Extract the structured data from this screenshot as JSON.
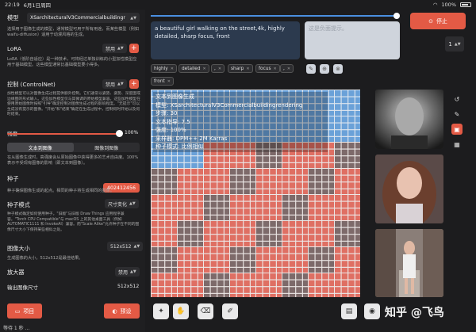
{
  "statusbar": {
    "time": "22:19",
    "date": "6月1日周四",
    "battery": "100%"
  },
  "left": {
    "model_label": "模型",
    "model_value": "XSarchitecturalV3Commercialbuildingr",
    "model_desc": "选择用于图像生成的模型，通常模型可用于所有用途，而某些模型（例如 waifu-diffusion）适用于动漫风格的生成。",
    "lora_label": "LoRA",
    "lora_value": "禁用",
    "lora_desc": "LoRA（低阶自适应）是一种技术，可将经过单独训练的小型加性模型应用于基础模型。这些模型通常比基础模型要小得多。",
    "controlnet_label": "控制 (ControlNet)",
    "controlnet_value": "禁用",
    "controlnet_desc": "加性模型可以对图像生成过程提供额外控制。它们通常以姿势、姿势、深度图或边缘图的形式输入。这些加性模型仅与其微调的原始模型兼容。这些加性模型在使用原始图像时按照\"引导\"确定控制对图像生成过程的影响程度。\"无提示\"可以生成没有提示的图像。\"开始\"和\"结束\"确定在生成过程中，控制何时开始以及何时结束。",
    "strength_label": "强度",
    "strength_value": "100%",
    "strength_fraction": 1.0,
    "mode_tabs": [
      "文本到图像",
      "图像到图像"
    ],
    "mode_desc": "在从图像生成时，高强度会从原始图像中获得更多的艺术自由度。100% 表示不受现有图像的影响（即文本到图像）。",
    "seed_label": "种子",
    "seed_value": "402412456",
    "seed_desc": "种子确保图像生成的起点。相同的种子将生成相同的图像。",
    "seed_mode_label": "种子模式",
    "seed_mode_value": "尺寸变化",
    "seed_mode_desc": "种子模式确定如何使用种子。\"旧版\"与旧版 Draw Things 应用程序兼容。\"Torch CPU Compatible\"与 macOS 上的其他桌面工具（例如 AUTOMATIC1111 和 InvokeAI）兼容。而\"Scale Alike\"允许种子在不同的图像尺寸大小下保持某些相似之处。",
    "size_label": "图像大小",
    "size_value": "512x512",
    "size_desc": "生成图像的大小。512x512是最佳结果。",
    "upscaler_label": "放大器",
    "upscaler_value": "禁用",
    "output_size_label": "输出图像尺寸",
    "output_size_value": "512x512",
    "project_btn": "项目",
    "preset_btn": "预设",
    "status_text": "等待 1 秒 ..."
  },
  "prompt": {
    "text": "a beautiful girl walking on the street,4k, highly detailed, sharp focus, front",
    "negative_placeholder": "这是负面提示。",
    "tags": [
      "highly",
      "detailed",
      ",",
      "sharp",
      "focus",
      ",",
      "front"
    ]
  },
  "actions": {
    "stop": "停止",
    "count": "1"
  },
  "canvas": {
    "info_lines": [
      "文本到图像生成",
      "模型: XSarchitecturalV3Commercialbuildingrendering",
      "步骤: 30",
      "文本指导: 7.5",
      "强度: 100%",
      "采样器: DPM++ 2M Karras",
      "种子模式: 比例相似"
    ]
  },
  "watermark": "知乎 @飞鸟",
  "colors": {
    "accent": "#e35a45",
    "prompt_bg": "#2c3a4e",
    "grid_red": "#df6f63",
    "grid_blue": "#6aa1d8"
  }
}
